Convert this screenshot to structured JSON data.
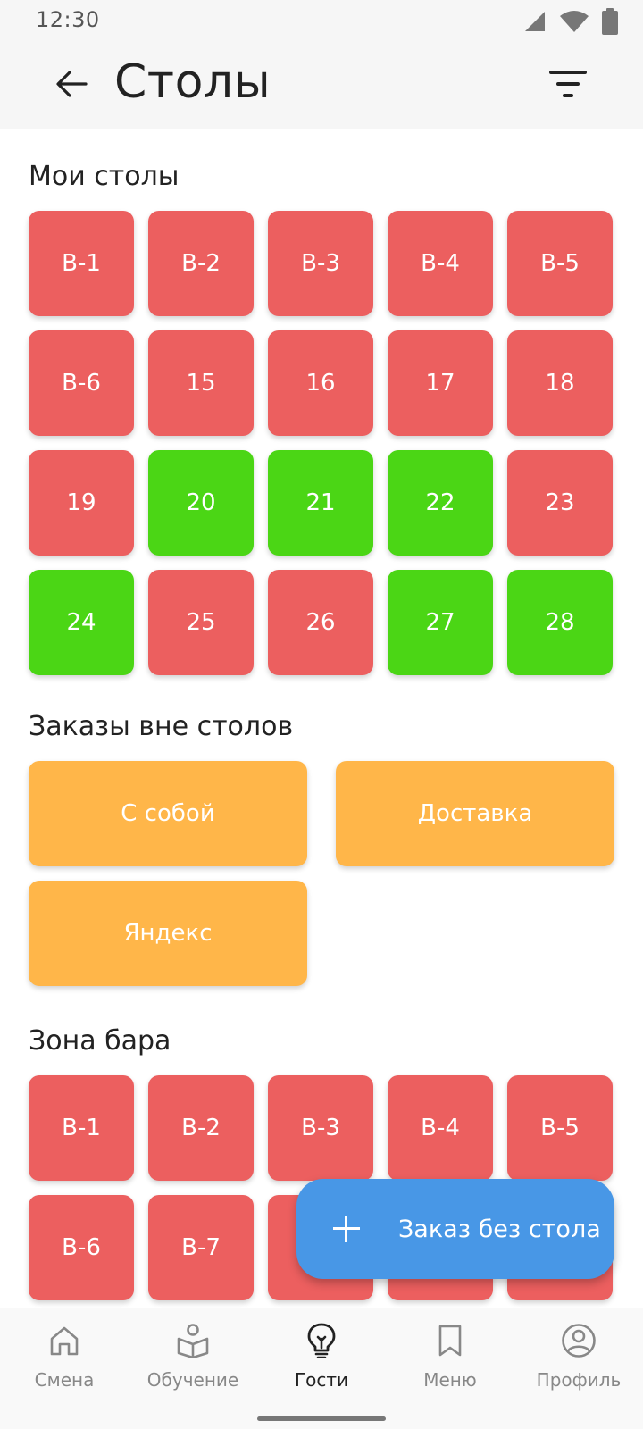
{
  "status_bar": {
    "time": "12:30"
  },
  "app_bar": {
    "title": "Столы"
  },
  "sections": {
    "my_tables": {
      "title": "Мои столы",
      "tables": [
        {
          "label": "В-1",
          "status": "red"
        },
        {
          "label": "В-2",
          "status": "red"
        },
        {
          "label": "В-3",
          "status": "red"
        },
        {
          "label": "В-4",
          "status": "red"
        },
        {
          "label": "В-5",
          "status": "red"
        },
        {
          "label": "В-6",
          "status": "red"
        },
        {
          "label": "15",
          "status": "red"
        },
        {
          "label": "16",
          "status": "red"
        },
        {
          "label": "17",
          "status": "red"
        },
        {
          "label": "18",
          "status": "red"
        },
        {
          "label": "19",
          "status": "red"
        },
        {
          "label": "20",
          "status": "green"
        },
        {
          "label": "21",
          "status": "green"
        },
        {
          "label": "22",
          "status": "green"
        },
        {
          "label": "23",
          "status": "red"
        },
        {
          "label": "24",
          "status": "green"
        },
        {
          "label": "25",
          "status": "red"
        },
        {
          "label": "26",
          "status": "red"
        },
        {
          "label": "27",
          "status": "green"
        },
        {
          "label": "28",
          "status": "green"
        }
      ]
    },
    "off_table_orders": {
      "title": "Заказы вне столов",
      "items": [
        {
          "label": "С собой"
        },
        {
          "label": "Доставка"
        },
        {
          "label": "Яндекс"
        }
      ]
    },
    "bar_zone": {
      "title": "Зона бара",
      "tables": [
        {
          "label": "В-1",
          "status": "red"
        },
        {
          "label": "В-2",
          "status": "red"
        },
        {
          "label": "В-3",
          "status": "red"
        },
        {
          "label": "В-4",
          "status": "red"
        },
        {
          "label": "В-5",
          "status": "red"
        },
        {
          "label": "В-6",
          "status": "red"
        },
        {
          "label": "В-7",
          "status": "red"
        },
        {
          "label": "",
          "status": "red"
        },
        {
          "label": "",
          "status": "red"
        },
        {
          "label": "",
          "status": "red"
        }
      ]
    }
  },
  "fab": {
    "label": "Заказ без стола",
    "icon": "plus-icon"
  },
  "bottom_nav": {
    "active": "Гости",
    "items": [
      {
        "label": "Смена",
        "icon": "home-icon"
      },
      {
        "label": "Обучение",
        "icon": "book-reader-icon"
      },
      {
        "label": "Гости",
        "icon": "lightbulb-icon"
      },
      {
        "label": "Меню",
        "icon": "bookmark-icon"
      },
      {
        "label": "Профиль",
        "icon": "profile-icon"
      }
    ]
  },
  "colors": {
    "occupied": "#ec5f5f",
    "free": "#4bd615",
    "off_table": "#ffb649",
    "fab": "#4897e6"
  }
}
